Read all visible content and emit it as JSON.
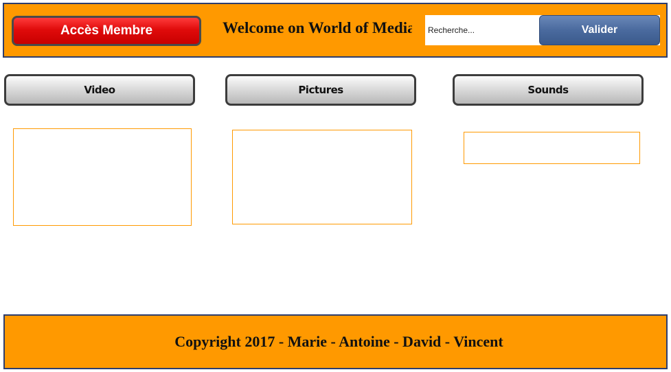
{
  "header": {
    "member_button_label": "Accès Membre",
    "title": "Welcome on World of Media",
    "search": {
      "placeholder": "Recherche...",
      "value": "",
      "submit_label": "Valider"
    }
  },
  "categories": [
    {
      "label": "Video"
    },
    {
      "label": "Pictures"
    },
    {
      "label": "Sounds"
    }
  ],
  "footer": {
    "copyright": "Copyright 2017 - Marie - Antoine - David - Vincent"
  },
  "colors": {
    "header_background": "#ff9900",
    "border": "#2d3d6e",
    "member_button": "#e00b0b",
    "search_button": "#4a6a9e",
    "panel_border": "#ff9900"
  }
}
